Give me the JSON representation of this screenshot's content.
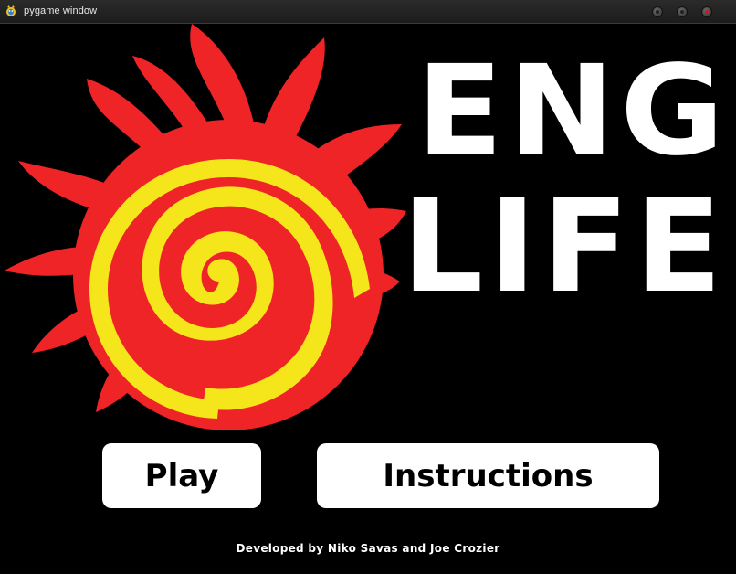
{
  "window": {
    "title": "pygame window"
  },
  "game": {
    "title_line1": "ENG",
    "title_line2": "LIFE",
    "play_label": "Play",
    "instructions_label": "Instructions",
    "credits": "Developed by Niko Savas and Joe Crozier"
  },
  "colors": {
    "background": "#000000",
    "logo_red": "#ee2426",
    "logo_yellow": "#f5e61c",
    "text": "#ffffff",
    "button_bg": "#ffffff",
    "button_text": "#000000"
  },
  "icons": {
    "window_icon": "pygame-snake-icon",
    "logo": "sun-spiral-logo",
    "minimize": "minimize-icon",
    "maximize": "maximize-icon",
    "close": "close-icon"
  }
}
